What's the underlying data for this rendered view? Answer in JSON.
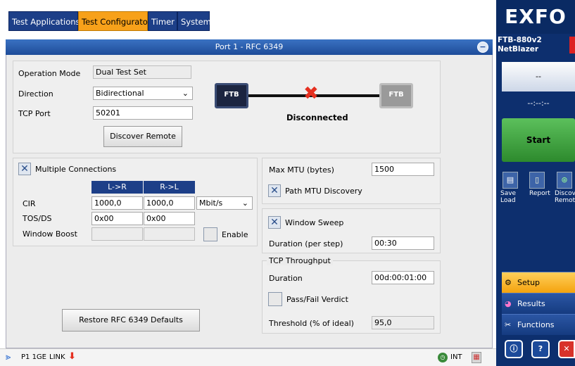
{
  "tabs": [
    {
      "label": "Test Applications"
    },
    {
      "label": "Test Configurator"
    },
    {
      "label": "Timer"
    },
    {
      "label": "System"
    }
  ],
  "panel": {
    "title": "Port 1 - RFC 6349"
  },
  "config": {
    "operation_mode_label": "Operation Mode",
    "operation_mode_value": "Dual Test Set",
    "direction_label": "Direction",
    "direction_value": "Bidirectional",
    "tcp_port_label": "TCP Port",
    "tcp_port_value": "50201",
    "discover_remote": "Discover Remote",
    "device_local": "FTB",
    "device_remote": "FTB",
    "link_status": "Disconnected"
  },
  "multi": {
    "checkbox_label": "Multiple Connections",
    "col_lr": "L->R",
    "col_rl": "R->L",
    "cir_label": "CIR",
    "cir_lr": "1000,0",
    "cir_rl": "1000,0",
    "cir_unit": "Mbit/s",
    "tos_label": "TOS/DS",
    "tos_lr": "0x00",
    "tos_rl": "0x00",
    "wb_label": "Window Boost",
    "enable_label": "Enable"
  },
  "mtu": {
    "label": "Max MTU (bytes)",
    "value": "1500",
    "path_discovery": "Path MTU Discovery"
  },
  "sweep": {
    "checkbox": "Window Sweep",
    "duration_label": "Duration (per step)",
    "duration_value": "00:30"
  },
  "throughput": {
    "title": "TCP Throughput",
    "duration_label": "Duration",
    "duration_value": "00d:00:01:00",
    "passfail": "Pass/Fail Verdict",
    "threshold_label": "Threshold (% of ideal)",
    "threshold_value": "95,0"
  },
  "restore": "Restore RFC 6349 Defaults",
  "status": {
    "port": "P1 1GE",
    "link": "LINK",
    "int": "INT"
  },
  "side": {
    "logo": "EXFO",
    "model": "FTB-880v2",
    "product": "NetBlazer",
    "timer_top": "--",
    "timer_bottom": "--:--:--",
    "start": "Start",
    "icons": [
      {
        "label": "Save\nLoad"
      },
      {
        "label": "Report"
      },
      {
        "label": "Discove\nRemot"
      }
    ],
    "nav": [
      {
        "label": "Setup"
      },
      {
        "label": "Results"
      },
      {
        "label": "Functions"
      }
    ]
  }
}
